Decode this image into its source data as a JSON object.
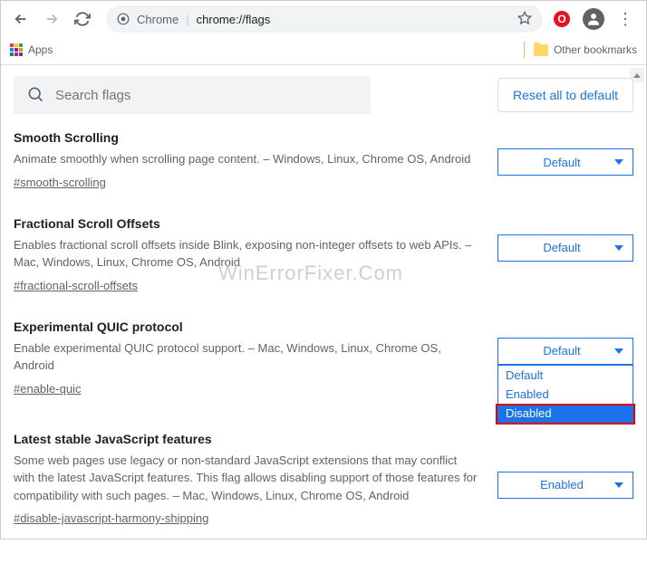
{
  "toolbar": {
    "addr_label": "Chrome",
    "addr_url": "chrome://flags"
  },
  "bookmarks": {
    "apps": "Apps",
    "other": "Other bookmarks"
  },
  "search": {
    "placeholder": "Search flags"
  },
  "reset_button": "Reset all to default",
  "flags": [
    {
      "title": "Smooth Scrolling",
      "desc": "Animate smoothly when scrolling page content. – Windows, Linux, Chrome OS, Android",
      "hash": "#smooth-scrolling",
      "value": "Default"
    },
    {
      "title": "Fractional Scroll Offsets",
      "desc": "Enables fractional scroll offsets inside Blink, exposing non-integer offsets to web APIs. – Mac, Windows, Linux, Chrome OS, Android",
      "hash": "#fractional-scroll-offsets",
      "value": "Default"
    },
    {
      "title": "Experimental QUIC protocol",
      "desc": "Enable experimental QUIC protocol support. – Mac, Windows, Linux, Chrome OS, Android",
      "hash": "#enable-quic",
      "value": "Default",
      "dropdown_open": true,
      "options": [
        "Default",
        "Enabled",
        "Disabled"
      ],
      "selected_option": "Disabled"
    },
    {
      "title": "Latest stable JavaScript features",
      "desc": "Some web pages use legacy or non-standard JavaScript extensions that may conflict with the latest JavaScript features. This flag allows disabling support of those features for compatibility with such pages. – Mac, Windows, Linux, Chrome OS, Android",
      "hash": "#disable-javascript-harmony-shipping",
      "value": "Enabled"
    }
  ],
  "watermark": "WinErrorFixer.Com"
}
